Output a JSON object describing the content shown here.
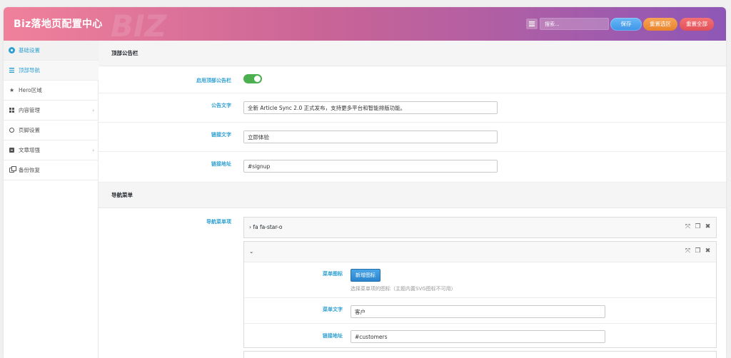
{
  "header": {
    "title": "Biz落地页配置中心",
    "watermark": "BIZ",
    "search_placeholder": "搜索...",
    "save_label": "保存",
    "reset_section_label": "重置选区",
    "reset_all_label": "重置全部"
  },
  "sidebar": {
    "items": [
      {
        "label": "基础设置",
        "icon": "gear-icon",
        "active": true,
        "has_children": false
      },
      {
        "label": "顶部导航",
        "icon": "bars-icon",
        "active": true,
        "has_children": false
      },
      {
        "label": "Hero区域",
        "icon": "star-icon",
        "active": false,
        "has_children": false
      },
      {
        "label": "内容管理",
        "icon": "grid-icon",
        "active": false,
        "has_children": true
      },
      {
        "label": "页脚设置",
        "icon": "copyright-icon",
        "active": false,
        "has_children": false
      },
      {
        "label": "文章增强",
        "icon": "document-icon",
        "active": false,
        "has_children": true
      },
      {
        "label": "备份恢复",
        "icon": "files-icon",
        "active": false,
        "has_children": false
      }
    ]
  },
  "announcement": {
    "section_title": "顶部公告栏",
    "enable_label": "启用顶部公告栏",
    "enabled": true,
    "text_label": "公告文字",
    "text_value": "全新 Article Sync 2.0 正式发布，支持更多平台和智能排版功能。",
    "link_text_label": "链接文字",
    "link_text_value": "立即体验",
    "link_url_label": "链接地址",
    "link_url_value": "#signup"
  },
  "nav_menu": {
    "section_title": "导航菜单",
    "items_label": "导航菜单项",
    "group1_title": "fa fa-star-o",
    "group2": {
      "icon_label": "菜单图标",
      "add_icon_button": "新增图标",
      "icon_hint": "选择菜单项的图标（主题内置SVG图标不可用）",
      "text_label": "菜单文字",
      "text_value": "客户",
      "url_label": "链接地址",
      "url_value": "#customers"
    }
  },
  "colors": {
    "accent": "#2e9fd3",
    "toggle_on": "#4caf50",
    "save": "#3d95e8",
    "reset_section": "#e9842b",
    "reset_all": "#e24f59"
  }
}
